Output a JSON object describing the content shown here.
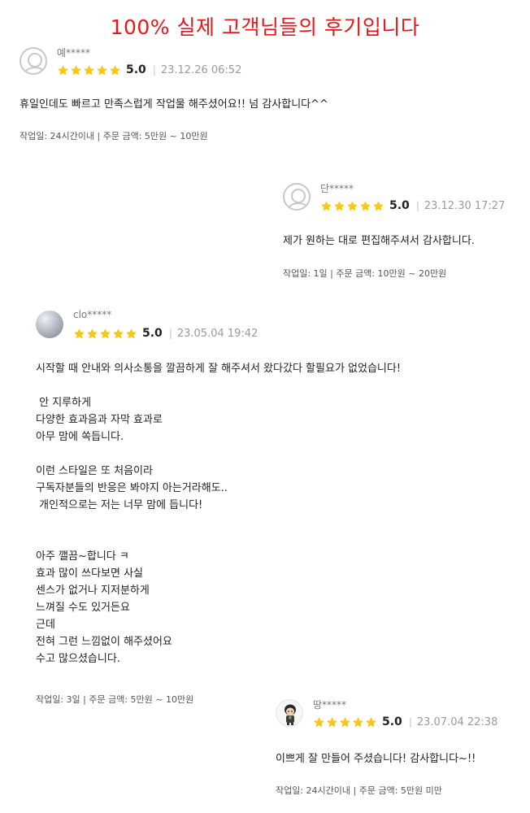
{
  "page": {
    "title": "100% 실제 고객님들의 후기입니다",
    "colors": {
      "title": "#e8181a",
      "star": "#f7c71b"
    }
  },
  "reviews": [
    {
      "username": "예*****",
      "avatar": "default-avatar-icon",
      "stars": 5,
      "score": "5.0",
      "separator": "|",
      "date": "23.12.26 06:52",
      "lines": [
        "휴일인데도 빠르고 만족스럽게 작업물 해주셨어요!! 넘 감사합니다^^"
      ],
      "meta": "작업일: 24시간이내 | 주문 금액: 5만원 ~ 10만원"
    },
    {
      "username": "단*****",
      "avatar": "default-avatar-icon",
      "stars": 5,
      "score": "5.0",
      "separator": "|",
      "date": "23.12.30 17:27",
      "lines": [
        "제가 원하는 대로 편집해주셔서 감사합니다."
      ],
      "meta": "작업일: 1일 | 주문 금액: 10만원 ~ 20만원"
    },
    {
      "username": "clo*****",
      "avatar": "photo-avatar",
      "stars": 5,
      "score": "5.0",
      "separator": "|",
      "date": "23.05.04 19:42",
      "lines": [
        "시작할 때 안내와 의사소통을 깔끔하게 잘 해주셔서 왔다갔다 할필요가 없었습니다!",
        "",
        " 안 지루하게",
        "다양한 효과음과 자막 효과로",
        "아무 맘에 쏙듭니다.",
        "",
        "이런 스타일은 또 처음이라",
        "구독자분들의 반응은 봐야지 아는거라해도..",
        " 개인적으로는 저는 너무 맘에 듭니다!",
        "",
        "",
        "아주 깰끔~합니다 ㅋ",
        "효과 많이 쓰다보면 사실",
        "센스가 없거나 지저분하게",
        "느껴질 수도 있거든요",
        "근데",
        "전혀 그런 느낌없이 해주셨어요",
        "수고 많으셨습니다."
      ],
      "meta": "작업일: 3일 | 주문 금액: 5만원 ~ 10만원"
    },
    {
      "username": "땅*****",
      "avatar": "character-avatar",
      "stars": 5,
      "score": "5.0",
      "separator": "|",
      "date": "23.07.04 22:38",
      "lines": [
        "이쁘게 잘 만들어 주셨습니다! 감사합니다~!!"
      ],
      "meta": "작업일: 24시간이내 | 주문 금액: 5만원 미만"
    }
  ]
}
